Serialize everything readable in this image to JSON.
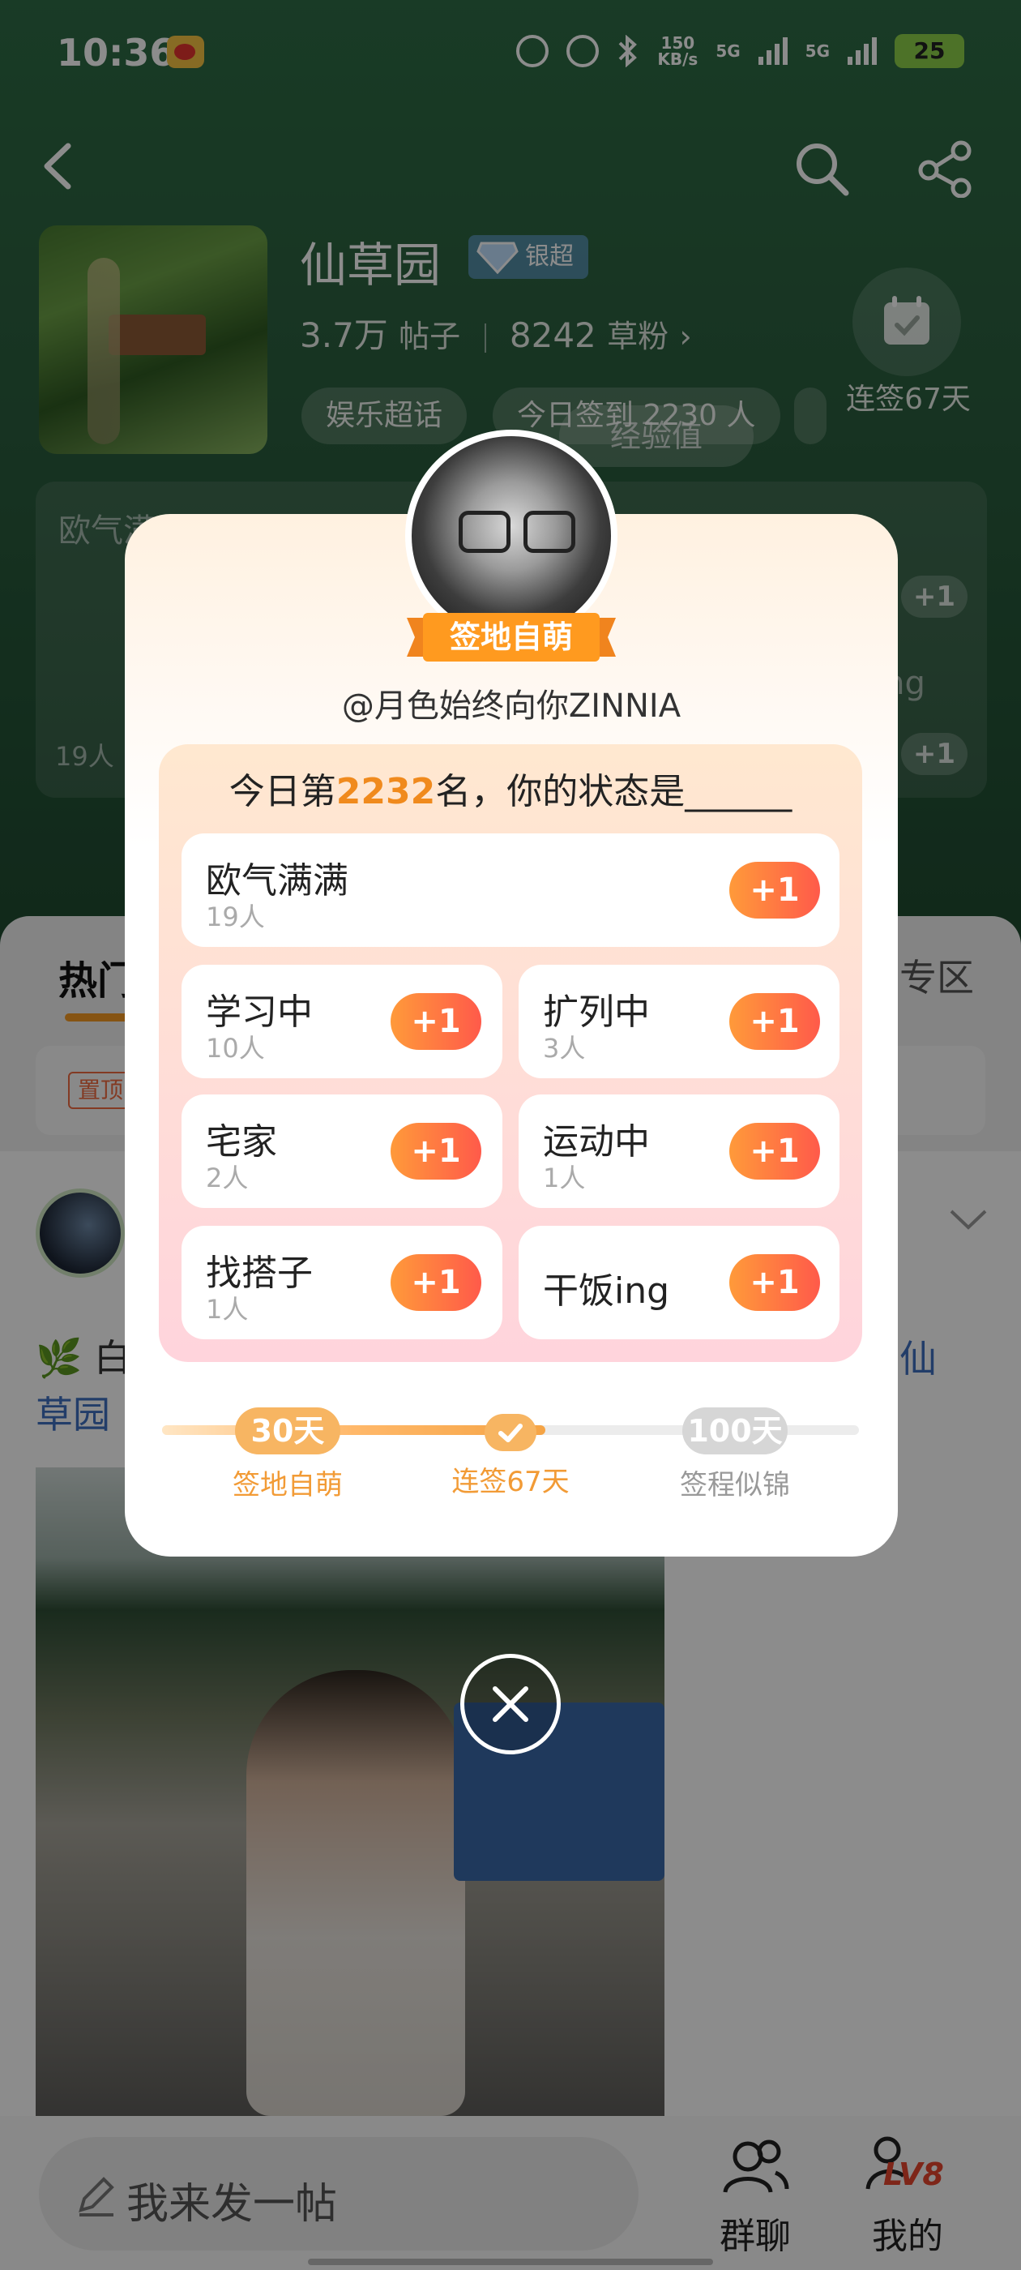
{
  "status_bar": {
    "time": "10:36",
    "net_speed_value": "150",
    "net_speed_unit": "KB/s",
    "signal_1": "5G",
    "signal_2": "5G",
    "battery": "25"
  },
  "group": {
    "name": "仙草园",
    "super_badge": "银超",
    "posts_count": "3.7万",
    "posts_label": "帖子",
    "fans_count": "8242",
    "fans_label": "草粉",
    "tags": [
      "娱乐超话",
      "今日签到 2230 人"
    ],
    "checkin_label": "连签67天",
    "exp_label": "经验值"
  },
  "background": {
    "faded_title": "欧气满满",
    "faded_count": "19人",
    "faded_item": "ing",
    "plus": "+1",
    "tab_hot": "热门",
    "tab_right": "专区",
    "pin_badge": "置顶",
    "post_text_1": "白",
    "post_text_2": "草园",
    "post_link": "仙"
  },
  "modal": {
    "rank_title": "签地自萌",
    "username": "@月色始终向你ZINNIA",
    "question_prefix": "今日第",
    "rank_number": "2232",
    "question_suffix": "名，你的状态是______",
    "plus_label": "+1",
    "options": [
      {
        "label": "欧气满满",
        "count": "19人"
      },
      {
        "label": "学习中",
        "count": "10人"
      },
      {
        "label": "扩列中",
        "count": "3人"
      },
      {
        "label": "宅家",
        "count": "2人"
      },
      {
        "label": "运动中",
        "count": "1人"
      },
      {
        "label": "找搭子",
        "count": "1人"
      },
      {
        "label": "干饭ing",
        "count": ""
      }
    ],
    "milestones": [
      {
        "badge": "30天",
        "label": "签地自萌"
      },
      {
        "badge": "",
        "label": "连签67天"
      },
      {
        "badge": "100天",
        "label": "签程似锦"
      }
    ],
    "progress_fraction": 0.55
  },
  "bottom_bar": {
    "compose_placeholder": "我来发一帖",
    "group_chat": "群聊",
    "mine": "我的",
    "level": "LV8"
  },
  "colors": {
    "accent_orange": "#f08a1d",
    "plus_gradient_start": "#ff9a3a",
    "plus_gradient_end": "#ff5a4a",
    "header_green": "#2e6c45"
  }
}
